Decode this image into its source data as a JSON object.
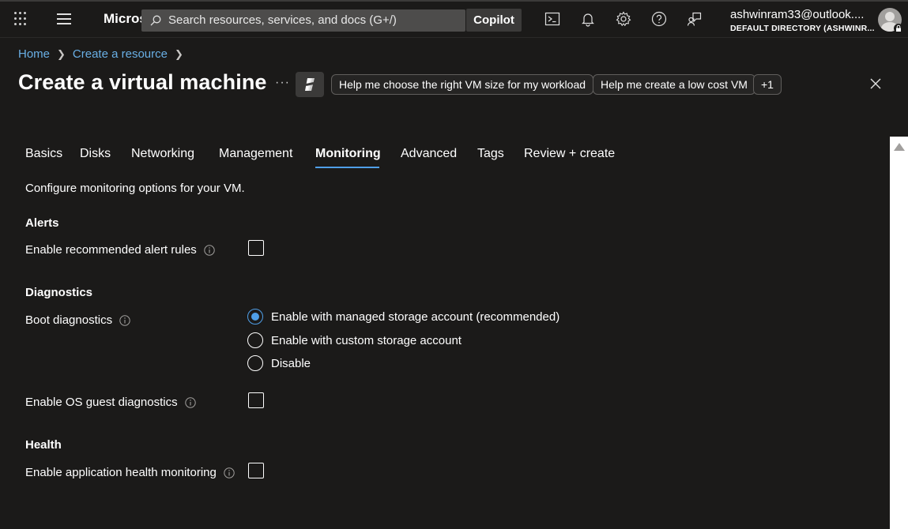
{
  "topbar": {
    "brand": "Micros",
    "search_placeholder": "Search resources, services, and docs (G+/)",
    "copilot_label": "Copilot",
    "user_email": "ashwinram33@outlook....",
    "user_directory": "DEFAULT DIRECTORY (ASHWINR..."
  },
  "breadcrumb": {
    "items": [
      "Home",
      "Create a resource"
    ]
  },
  "title": "Create a virtual machine",
  "more_label": "···",
  "suggestions": [
    "Help me choose the right VM size for my workload",
    "Help me create a low cost VM",
    "+1"
  ],
  "tabs": [
    "Basics",
    "Disks",
    "Networking",
    "Management",
    "Monitoring",
    "Advanced",
    "Tags",
    "Review + create"
  ],
  "active_tab": "Monitoring",
  "description": "Configure monitoring options for your VM.",
  "alerts": {
    "title": "Alerts",
    "recommended_rules_label": "Enable recommended alert rules",
    "recommended_rules_checked": false
  },
  "diagnostics": {
    "title": "Diagnostics",
    "boot_label": "Boot diagnostics",
    "boot_options": [
      "Enable with managed storage account (recommended)",
      "Enable with custom storage account",
      "Disable"
    ],
    "boot_selected": "Enable with managed storage account (recommended)",
    "os_guest_label": "Enable OS guest diagnostics",
    "os_guest_checked": false
  },
  "health": {
    "title": "Health",
    "app_health_label": "Enable application health monitoring",
    "app_health_checked": false
  },
  "colors": {
    "background": "#1b1a19",
    "accent": "#4f9fe8",
    "link": "#69afe5"
  }
}
